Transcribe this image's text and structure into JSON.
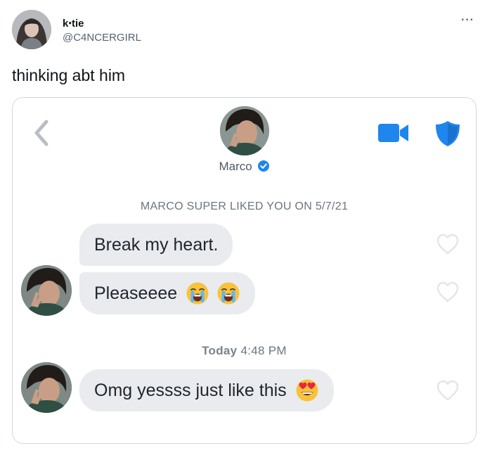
{
  "tweet": {
    "author_name": "kꞏtie",
    "author_handle": "@C4NCERGIRL",
    "more_label": "···",
    "text": "thinking abt him"
  },
  "chat": {
    "match_name": "Marco",
    "super_like_notice": "MARCO SUPER LIKED YOU ON 5/7/21",
    "day_label": "Today",
    "time_label": "4:48 PM",
    "messages": [
      {
        "text": "Break my heart.",
        "emojis": []
      },
      {
        "text": "Pleaseeee",
        "emojis": [
          "loudly-crying-face",
          "loudly-crying-face"
        ]
      },
      {
        "text": "Omg yessss just like this",
        "emojis": [
          "heart-eyes-face"
        ]
      }
    ]
  },
  "colors": {
    "tinder_blue": "#1f86ee",
    "bubble_bg": "#e9ebee",
    "card_border": "#cfd9de",
    "muted_text": "#6c757d",
    "heart_outline": "#e3e6e9"
  },
  "icons": [
    "back-chevron-icon",
    "video-call-icon",
    "safety-shield-icon",
    "verified-badge-icon",
    "heart-icon",
    "more-dots-icon"
  ]
}
